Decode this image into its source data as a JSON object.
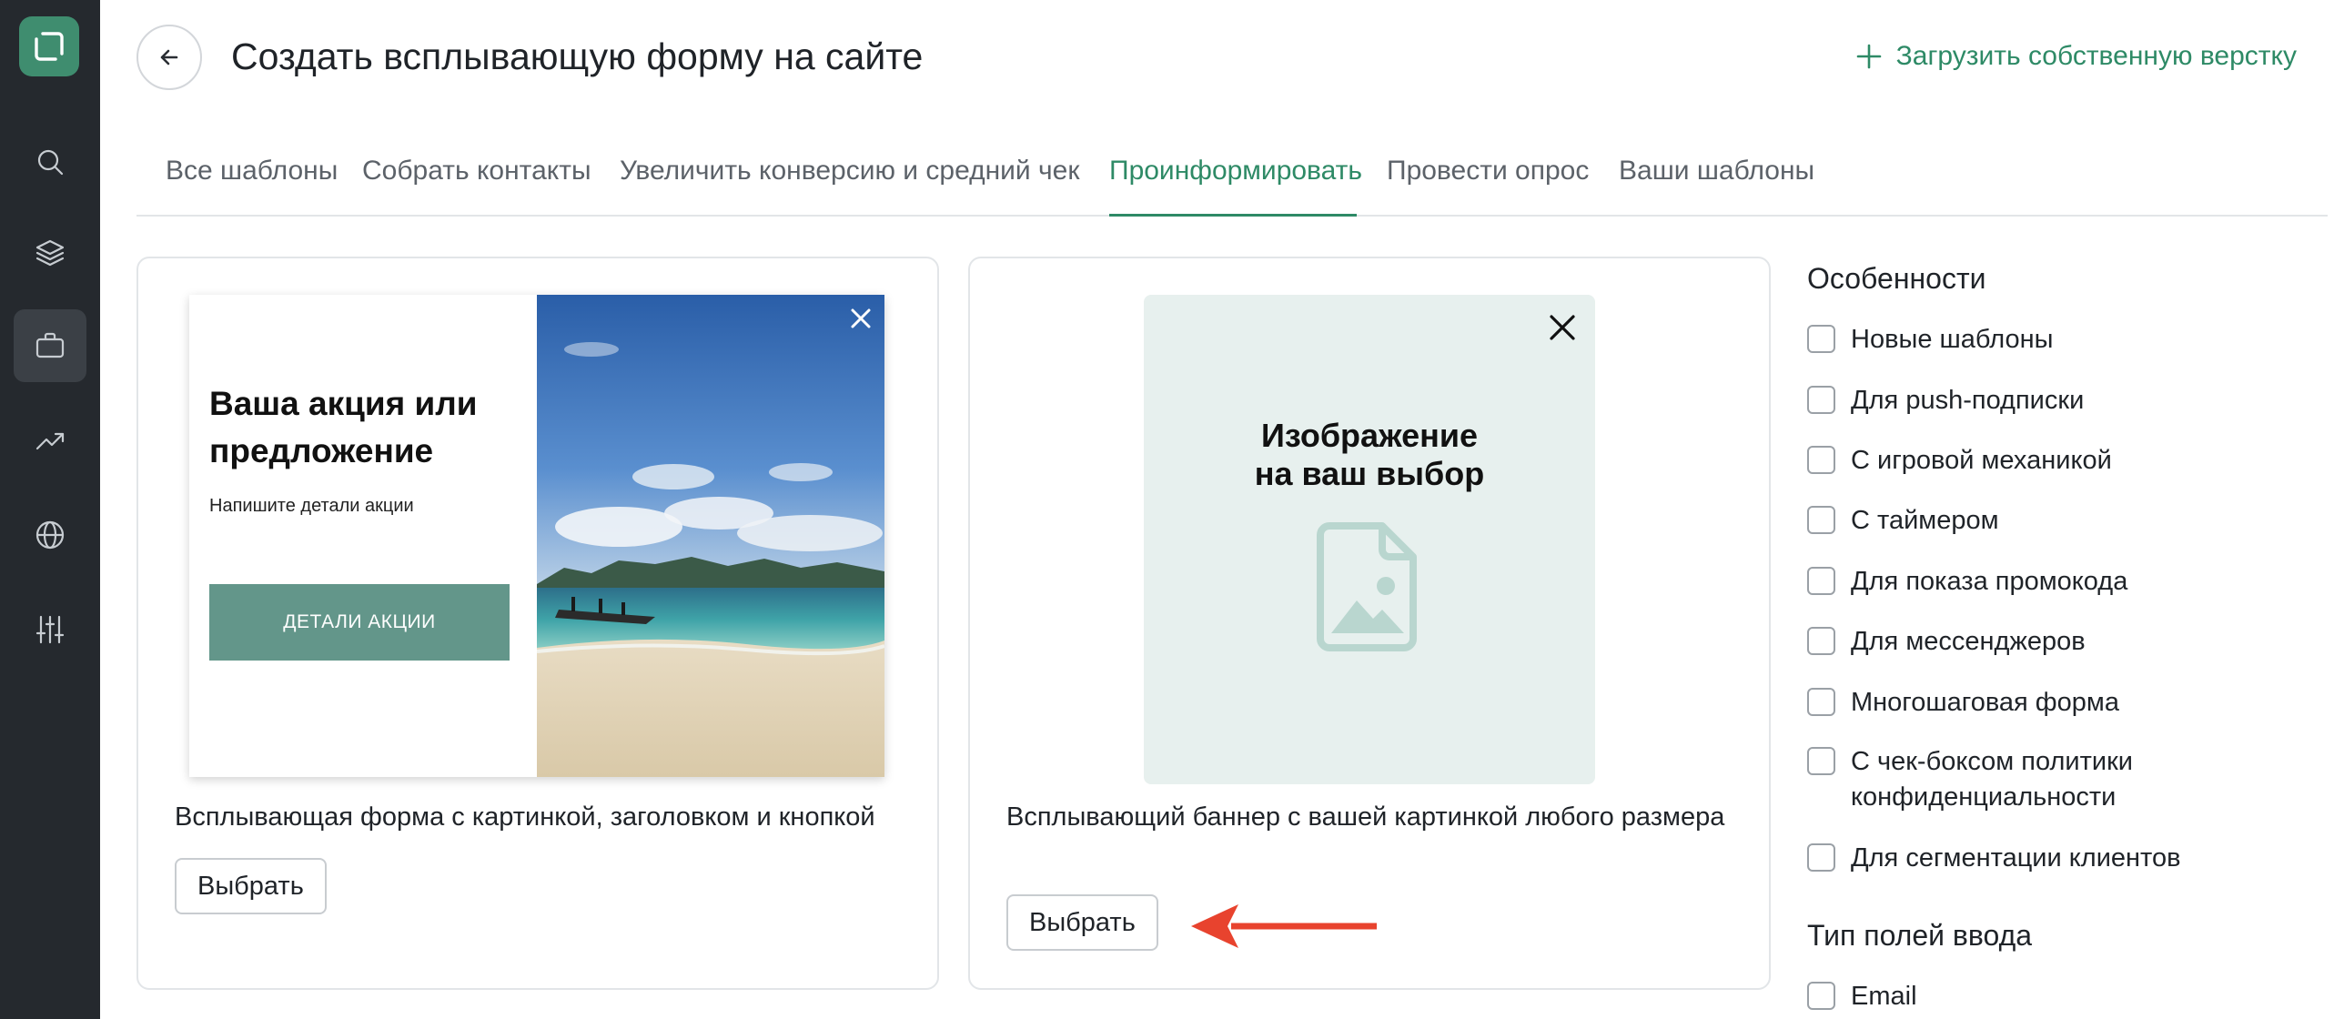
{
  "sidebar": {
    "items": [
      {
        "name": "search-icon"
      },
      {
        "name": "layers-icon"
      },
      {
        "name": "briefcase-icon",
        "active": true
      },
      {
        "name": "trending-up-icon"
      },
      {
        "name": "globe-icon"
      },
      {
        "name": "sliders-icon"
      }
    ]
  },
  "header": {
    "title": "Создать всплывающую форму на сайте",
    "upload_label": "Загрузить собственную верстку"
  },
  "tabs": [
    {
      "label": "Все шаблоны"
    },
    {
      "label": "Собрать контакты"
    },
    {
      "label": "Увеличить конверсию и средний чек"
    },
    {
      "label": "Проинформировать",
      "active": true
    },
    {
      "label": "Провести опрос"
    },
    {
      "label": "Ваши шаблоны"
    }
  ],
  "templates": [
    {
      "preview_heading": "Ваша акция или предложение",
      "preview_subtext": "Напишите детали акции",
      "preview_button": "ДЕТАЛИ АКЦИИ",
      "title": "Всплывающая форма с картинкой, заголовком и кнопкой",
      "choose_label": "Выбрать"
    },
    {
      "preview_line1": "Изображение",
      "preview_line2": "на ваш выбор",
      "title": "Всплывающий баннер с вашей картинкой любого размера",
      "choose_label": "Выбрать"
    }
  ],
  "filters": {
    "features_heading": "Особенности",
    "features": [
      {
        "label": "Новые шаблоны",
        "checked": false
      },
      {
        "label": "Для push-подписки",
        "checked": false
      },
      {
        "label": "С игровой механикой",
        "checked": false
      },
      {
        "label": "С таймером",
        "checked": false
      },
      {
        "label": "Для показа промокода",
        "checked": false
      },
      {
        "label": "Для мессенджеров",
        "checked": false
      },
      {
        "label": "Многошаговая форма",
        "checked": false
      },
      {
        "label": "С чек-боксом политики конфиденциальности",
        "checked": false
      },
      {
        "label": "Для сегментации клиентов",
        "checked": false
      }
    ],
    "input_types_heading": "Тип полей ввода",
    "input_types": [
      {
        "label": "Email",
        "checked": false
      }
    ]
  },
  "colors": {
    "accent": "#2e8a66",
    "sidebar_bg": "#25292e",
    "annotation_arrow": "#e8432e"
  }
}
